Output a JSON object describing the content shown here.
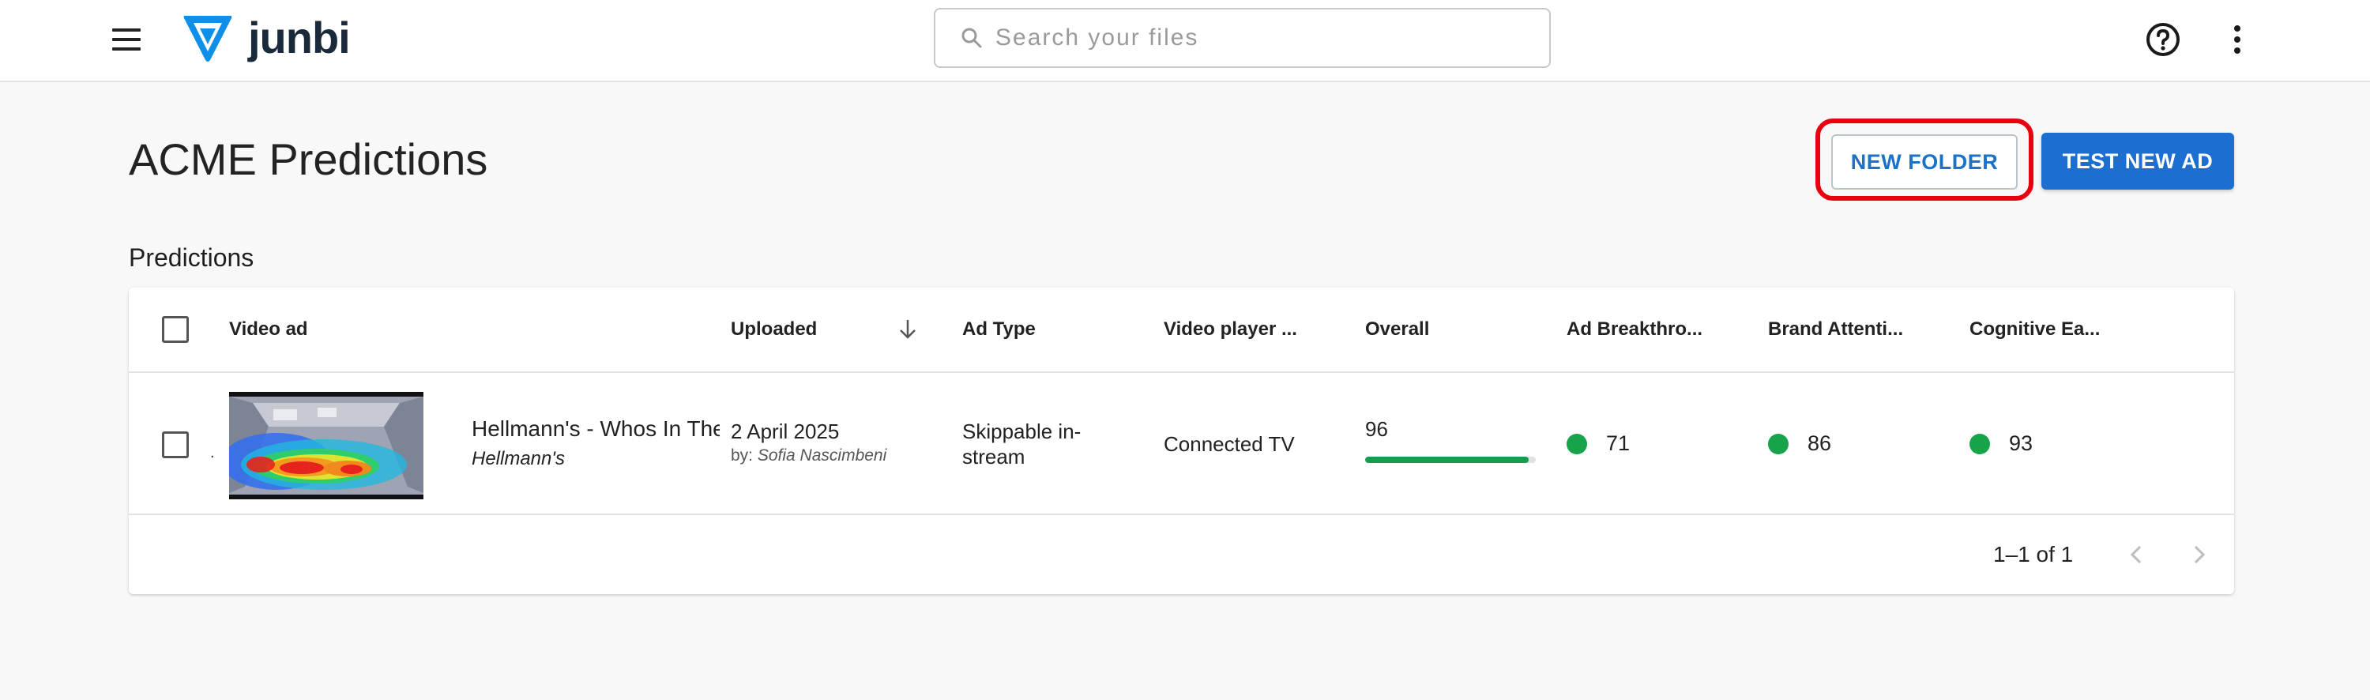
{
  "app": {
    "name": "junbi"
  },
  "search": {
    "placeholder": "Search your files"
  },
  "page": {
    "title": "ACME Predictions"
  },
  "actions": {
    "new_folder": "NEW FOLDER",
    "test_new_ad": "TEST NEW AD"
  },
  "section": {
    "label": "Predictions"
  },
  "table": {
    "headers": {
      "video_ad": "Video ad",
      "uploaded": "Uploaded",
      "ad_type": "Ad Type",
      "video_player": "Video player ...",
      "overall": "Overall",
      "ad_breakthrough": "Ad Breakthro...",
      "brand_attention": "Brand Attenti...",
      "cognitive_ease": "Cognitive Ea..."
    },
    "rows": [
      {
        "dot": ".",
        "title": "Hellmann's - Whos In The",
        "brand": "Hellmann's",
        "uploaded_date": "2 April 2025",
        "uploaded_by_prefix": "by:",
        "uploaded_by": "Sofia Nascimbeni",
        "ad_type_line1": "Skippable in-",
        "ad_type_line2": "stream",
        "video_player": "Connected TV",
        "overall": "96",
        "overall_fraction": 0.96,
        "ad_breakthrough": "71",
        "brand_attention": "86",
        "cognitive_ease": "93"
      }
    ]
  },
  "pagination": {
    "text": "1–1 of 1"
  },
  "colors": {
    "accent": "#1c6fd0",
    "highlight": "#e8000f",
    "score_good": "#16a34a",
    "bar_fill": "#179c4f"
  },
  "icons": [
    "menu-icon",
    "junbi-logo-icon",
    "search-icon",
    "help-icon",
    "more-vert-icon",
    "arrow-down-icon",
    "chevron-left-icon",
    "chevron-right-icon"
  ]
}
